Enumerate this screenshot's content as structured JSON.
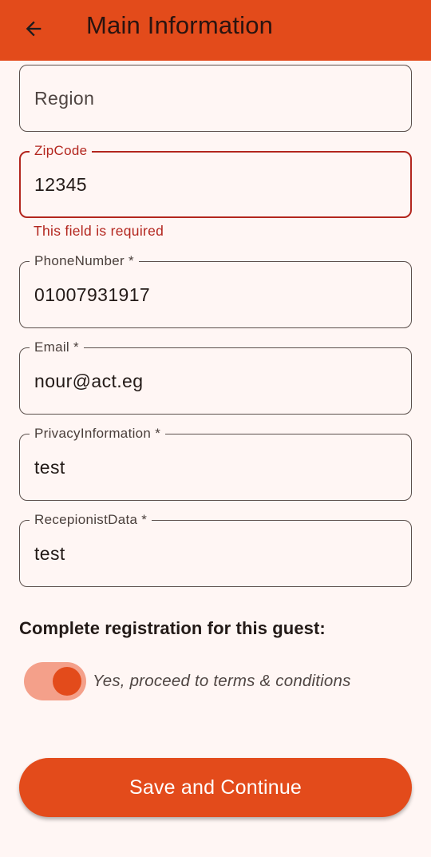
{
  "colors": {
    "primary": "#e34b1b",
    "error": "#b3261e",
    "background": "#fff6f4",
    "switch_track": "#f4a08a"
  },
  "appbar": {
    "back_icon": "arrow-back-icon",
    "title": "Main Information"
  },
  "form": {
    "region": {
      "placeholder": "Region",
      "value": ""
    },
    "zipcode": {
      "label": "ZipCode",
      "value": "12345",
      "error": "This field is required"
    },
    "phone": {
      "label": "PhoneNumber *",
      "value": "01007931917"
    },
    "email": {
      "label": "Email *",
      "value": "nour@act.eg"
    },
    "privacy": {
      "label": "PrivacyInformation *",
      "value": "test"
    },
    "receptionist": {
      "label": "RecepionistData *",
      "value": "test"
    }
  },
  "registration": {
    "section_label": "Complete registration for this guest:",
    "switch_text": "Yes, proceed to terms & conditions",
    "switch_on": true
  },
  "actions": {
    "save_label": "Save and Continue"
  }
}
